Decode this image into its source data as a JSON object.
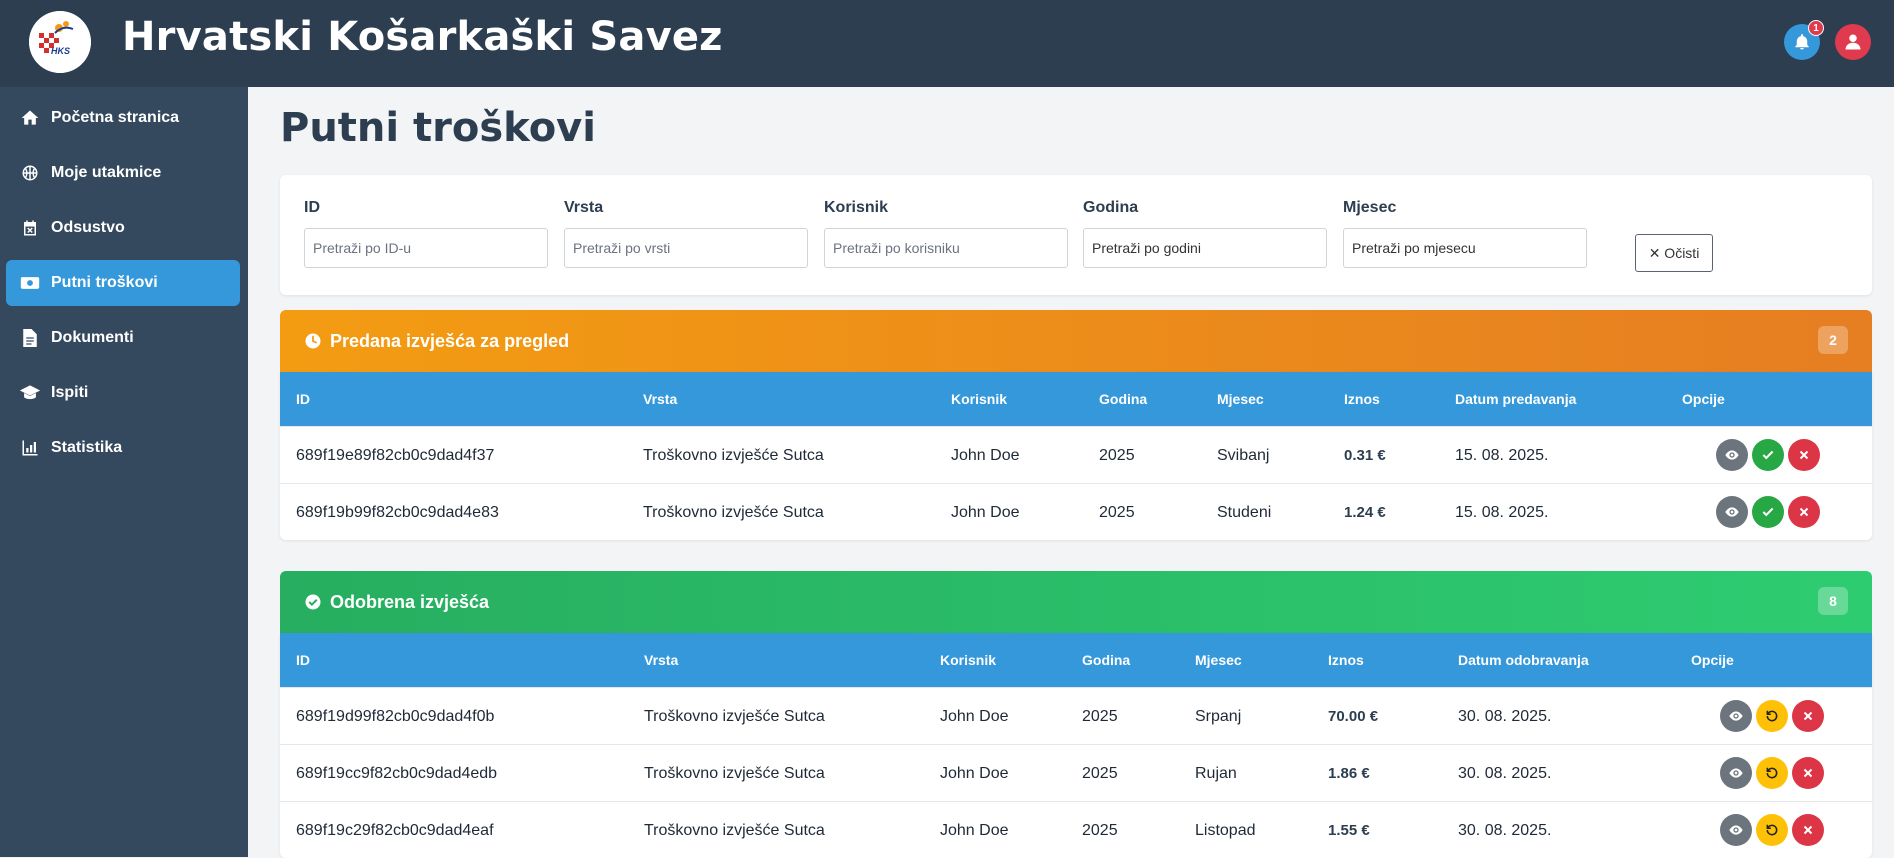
{
  "app": {
    "title": "Hrvatski Košarkaški Savez",
    "logo_text": "HKS",
    "notif_count": "1"
  },
  "colors": {
    "topbar": "#2c3e50",
    "sidebar": "#34495e",
    "accent": "#3498db",
    "pending": "#f39c12",
    "approved": "#27ae60",
    "danger": "#dc3545",
    "warning": "#ffc107"
  },
  "sidebar": {
    "items": [
      {
        "label": "Početna stranica",
        "icon": "home-icon"
      },
      {
        "label": "Moje utakmice",
        "icon": "basketball-icon"
      },
      {
        "label": "Odsustvo",
        "icon": "calendar-x-icon"
      },
      {
        "label": "Putni troškovi",
        "icon": "money-icon",
        "active": true
      },
      {
        "label": "Dokumenti",
        "icon": "document-icon"
      },
      {
        "label": "Ispiti",
        "icon": "graduation-cap-icon"
      },
      {
        "label": "Statistika",
        "icon": "chart-icon"
      }
    ]
  },
  "page": {
    "title": "Putni troškovi"
  },
  "filters": {
    "id": {
      "label": "ID",
      "placeholder": "Pretraži po ID-u"
    },
    "vrsta": {
      "label": "Vrsta",
      "placeholder": "Pretraži po vrsti"
    },
    "korisnik": {
      "label": "Korisnik",
      "placeholder": "Pretraži po korisniku"
    },
    "godina": {
      "label": "Godina",
      "placeholder": "Pretraži po godini"
    },
    "mjesec": {
      "label": "Mjesec",
      "placeholder": "Pretraži po mjesecu"
    },
    "clear_label": "✕ Očisti"
  },
  "pending": {
    "title": "Predana izvješća za pregled",
    "count": "2",
    "columns": [
      "ID",
      "Vrsta",
      "Korisnik",
      "Godina",
      "Mjesec",
      "Iznos",
      "Datum predavanja",
      "Opcije"
    ],
    "rows": [
      {
        "id": "689f19e89f82cb0c9dad4f37",
        "vrsta": "Troškovno izvješće Sutca",
        "korisnik": "John Doe",
        "godina": "2025",
        "mjesec": "Svibanj",
        "iznos": "0.31 €",
        "datum": "15. 08. 2025."
      },
      {
        "id": "689f19b99f82cb0c9dad4e83",
        "vrsta": "Troškovno izvješće Sutca",
        "korisnik": "John Doe",
        "godina": "2025",
        "mjesec": "Studeni",
        "iznos": "1.24 €",
        "datum": "15. 08. 2025."
      }
    ]
  },
  "approved": {
    "title": "Odobrena izvješća",
    "count": "8",
    "columns": [
      "ID",
      "Vrsta",
      "Korisnik",
      "Godina",
      "Mjesec",
      "Iznos",
      "Datum odobravanja",
      "Opcije"
    ],
    "rows": [
      {
        "id": "689f19d99f82cb0c9dad4f0b",
        "vrsta": "Troškovno izvješće Sutca",
        "korisnik": "John Doe",
        "godina": "2025",
        "mjesec": "Srpanj",
        "iznos": "70.00 €",
        "datum": "30. 08. 2025."
      },
      {
        "id": "689f19cc9f82cb0c9dad4edb",
        "vrsta": "Troškovno izvješće Sutca",
        "korisnik": "John Doe",
        "godina": "2025",
        "mjesec": "Rujan",
        "iznos": "1.86 €",
        "datum": "30. 08. 2025."
      },
      {
        "id": "689f19c29f82cb0c9dad4eaf",
        "vrsta": "Troškovno izvješće Sutca",
        "korisnik": "John Doe",
        "godina": "2025",
        "mjesec": "Listopad",
        "iznos": "1.55 €",
        "datum": "30. 08. 2025."
      }
    ]
  }
}
